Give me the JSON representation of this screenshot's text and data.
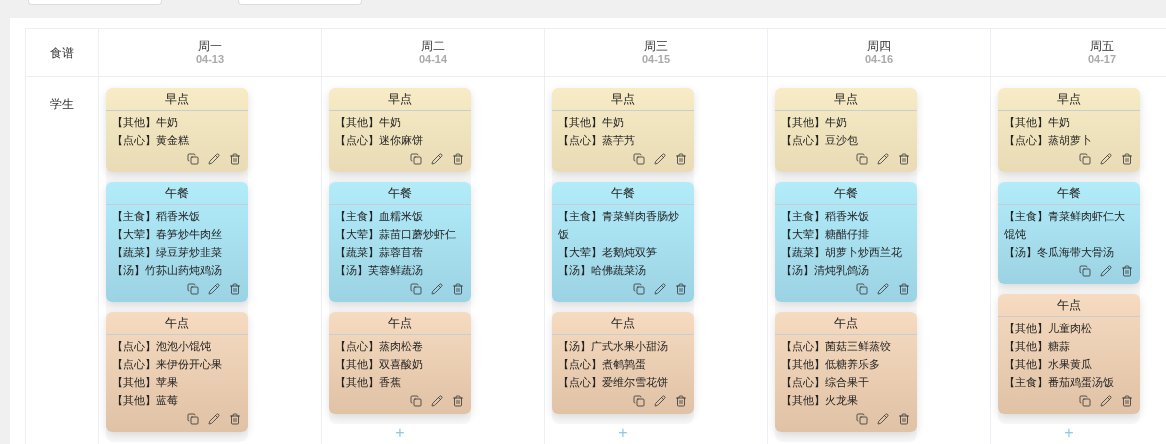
{
  "table": {
    "corner_label": "食谱",
    "row_label": "学生",
    "days": [
      {
        "weekday": "周一",
        "date": "04-13",
        "meals": [
          {
            "kind": "breakfast",
            "title": "早点",
            "items": [
              "【其他】牛奶",
              "【点心】黄金糕"
            ]
          },
          {
            "kind": "lunch",
            "title": "午餐",
            "items": [
              "【主食】稻香米饭",
              "【大荤】春笋炒牛肉丝",
              "【蔬菜】绿豆芽炒韭菜",
              "【汤】竹荪山药炖鸡汤"
            ]
          },
          {
            "kind": "snack",
            "title": "午点",
            "items": [
              "【点心】泡泡小馄饨",
              "【点心】来伊份开心果",
              "【其他】苹果",
              "【其他】蓝莓"
            ]
          }
        ]
      },
      {
        "weekday": "周二",
        "date": "04-14",
        "add_button": "+",
        "meals": [
          {
            "kind": "breakfast",
            "title": "早点",
            "items": [
              "【其他】牛奶",
              "【点心】迷你麻饼"
            ]
          },
          {
            "kind": "lunch",
            "title": "午餐",
            "items": [
              "【主食】血糯米饭",
              "【大荤】蒜苗口蘑炒虾仁",
              "【蔬菜】蒜蓉苜蓿",
              "【汤】芙蓉鲜蔬汤"
            ]
          },
          {
            "kind": "snack",
            "title": "午点",
            "items": [
              "【点心】蒸肉松卷",
              "【其他】双喜酸奶",
              "【其他】香蕉"
            ]
          }
        ]
      },
      {
        "weekday": "周三",
        "date": "04-15",
        "add_button": "+",
        "meals": [
          {
            "kind": "breakfast",
            "title": "早点",
            "items": [
              "【其他】牛奶",
              "【点心】蒸芋艿"
            ]
          },
          {
            "kind": "lunch",
            "title": "午餐",
            "items": [
              "【主食】青菜鲜肉香肠炒饭",
              "【大荤】老鹅炖双笋",
              "【汤】哈佛蔬菜汤"
            ]
          },
          {
            "kind": "snack",
            "title": "午点",
            "items": [
              "【汤】广式水果小甜汤",
              "【点心】煮鹌鹑蛋",
              "【点心】爱维尔雪花饼"
            ]
          }
        ]
      },
      {
        "weekday": "周四",
        "date": "04-16",
        "meals": [
          {
            "kind": "breakfast",
            "title": "早点",
            "items": [
              "【其他】牛奶",
              "【点心】豆沙包"
            ]
          },
          {
            "kind": "lunch",
            "title": "午餐",
            "items": [
              "【主食】稻香米饭",
              "【大荤】糖醋仔排",
              "【蔬菜】胡萝卜炒西兰花",
              "【汤】清炖乳鸽汤"
            ]
          },
          {
            "kind": "snack",
            "title": "午点",
            "items": [
              "【点心】菌菇三鲜蒸饺",
              "【其他】低糖养乐多",
              "【点心】综合果干",
              "【其他】火龙果"
            ]
          }
        ]
      },
      {
        "weekday": "周五",
        "date": "04-17",
        "add_button": "+",
        "meals": [
          {
            "kind": "breakfast",
            "title": "早点",
            "items": [
              "【其他】牛奶",
              "【点心】蒸胡萝卜"
            ]
          },
          {
            "kind": "lunch",
            "title": "午餐",
            "items": [
              "【主食】青菜鲜肉虾仁大馄饨",
              "【汤】冬瓜海带大骨汤"
            ]
          },
          {
            "kind": "snack",
            "title": "午点",
            "items": [
              "【其他】儿童肉松",
              "【其他】糖蒜",
              "【其他】水果黄瓜",
              "【主食】番茄鸡蛋汤饭"
            ]
          }
        ]
      }
    ]
  }
}
